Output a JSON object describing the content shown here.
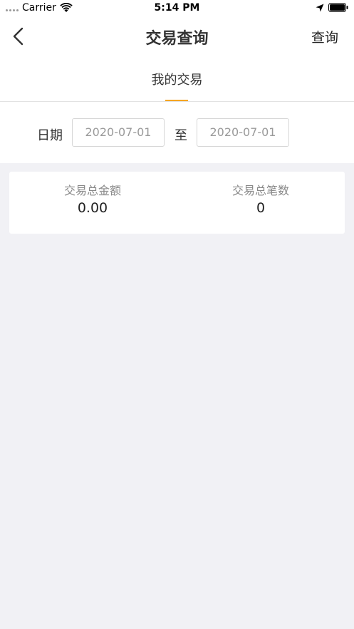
{
  "status_bar": {
    "carrier": "Carrier",
    "time": "5:14 PM",
    "icons": [
      "signal-dots-icon",
      "wifi-icon",
      "location-arrow-icon",
      "battery-icon"
    ]
  },
  "nav": {
    "title": "交易查询",
    "action_label": "查询",
    "back_icon": "chevron-left-icon"
  },
  "tabs": [
    {
      "label": "我的交易",
      "active": true
    }
  ],
  "date_filter": {
    "label": "日期",
    "separator": "至",
    "start": "2020-07-01",
    "end": "2020-07-01"
  },
  "summary": {
    "amount_label": "交易总金额",
    "amount_value": "0.00",
    "count_label": "交易总笔数",
    "count_value": "0"
  },
  "colors": {
    "accent": "#f5a623",
    "background": "#f1f1f5",
    "surface": "#ffffff"
  }
}
